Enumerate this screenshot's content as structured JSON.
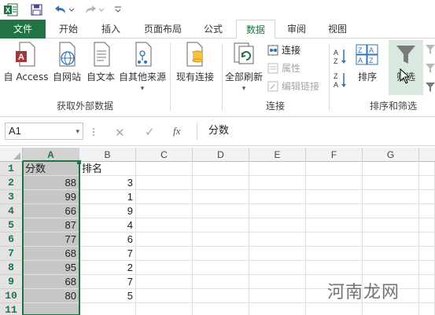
{
  "ribbon_tabs": [
    "文件",
    "开始",
    "插入",
    "页面布局",
    "公式",
    "数据",
    "审阅",
    "视图"
  ],
  "active_tab": "数据",
  "ribbon": {
    "get_external": {
      "from_access": "自 Access",
      "from_web": "自网站",
      "from_text": "自文本",
      "from_other": "自其他来源",
      "group_label": "获取外部数据"
    },
    "existing_connections": "现有连接",
    "connections": {
      "refresh_all": "全部刷新",
      "connections": "连接",
      "properties": "属性",
      "edit_links": "编辑链接",
      "group_label": "连接"
    },
    "sort_filter": {
      "sort": "排序",
      "filter": "筛选",
      "group_label": "排序和筛选"
    }
  },
  "formula_bar": {
    "name_box": "A1",
    "fx": "fx",
    "content": "分数"
  },
  "grid": {
    "columns": [
      "A",
      "B",
      "C",
      "D",
      "E",
      "F",
      "G"
    ],
    "selected_column": "A",
    "rows": [
      {
        "n": "1",
        "a": "分数",
        "b": "排名"
      },
      {
        "n": "2",
        "a": "88",
        "b": "3"
      },
      {
        "n": "3",
        "a": "99",
        "b": "1"
      },
      {
        "n": "4",
        "a": "66",
        "b": "9"
      },
      {
        "n": "5",
        "a": "87",
        "b": "4"
      },
      {
        "n": "6",
        "a": "77",
        "b": "6"
      },
      {
        "n": "7",
        "a": "68",
        "b": "7"
      },
      {
        "n": "8",
        "a": "95",
        "b": "2"
      },
      {
        "n": "9",
        "a": "68",
        "b": "7"
      },
      {
        "n": "10",
        "a": "80",
        "b": "5"
      },
      {
        "n": "11",
        "a": "",
        "b": ""
      }
    ]
  },
  "watermark": "河南龙网",
  "colors": {
    "excel_green": "#217346",
    "selection_gray": "#c6c6c6"
  }
}
